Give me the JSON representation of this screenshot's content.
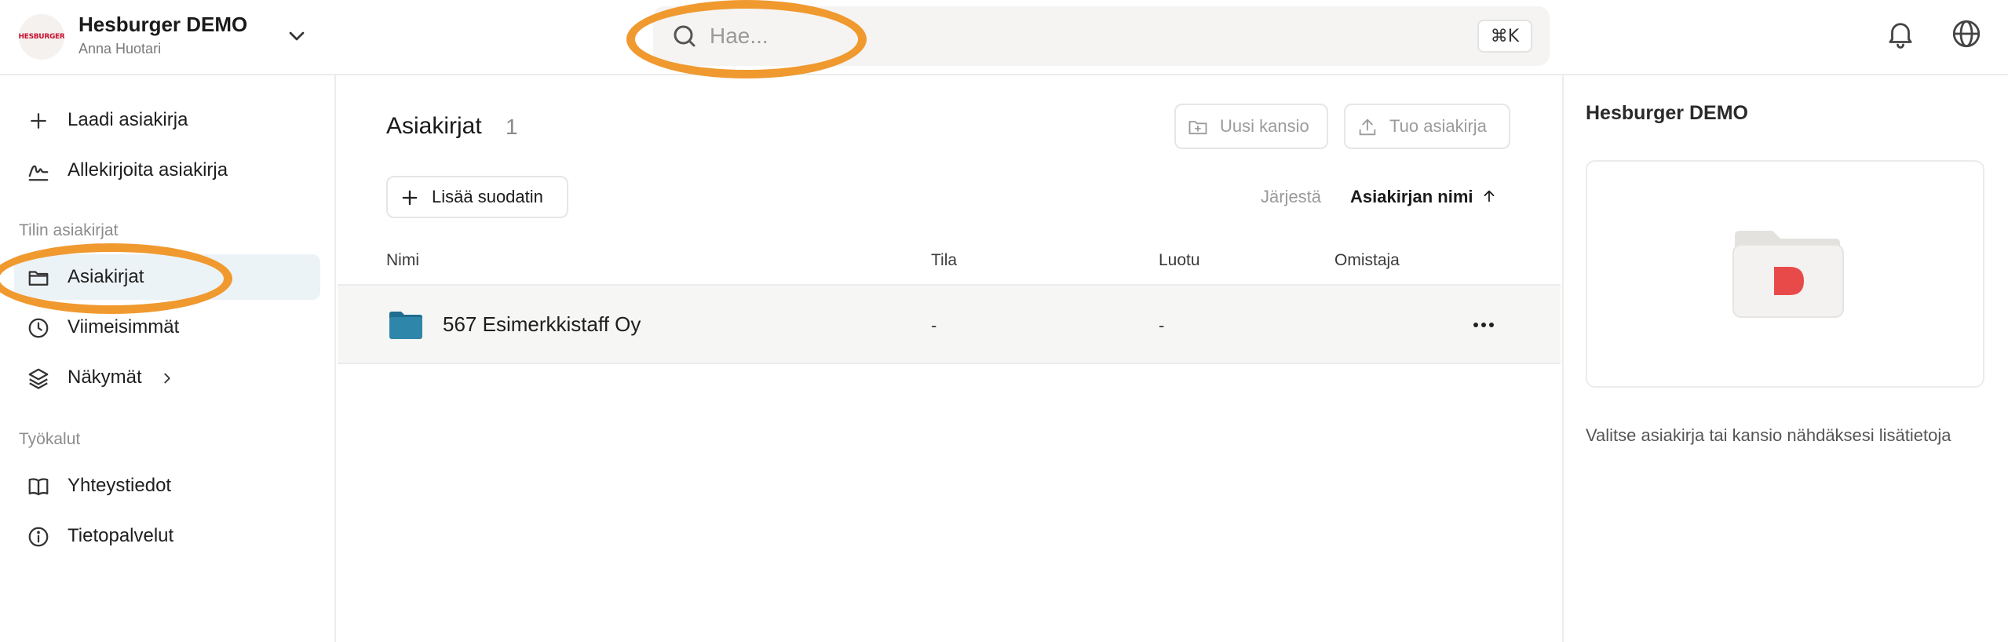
{
  "header": {
    "org_name": "Hesburger DEMO",
    "user_name": "Anna Huotari",
    "logo_text": "HESBURGER",
    "search_placeholder": "Hae...",
    "search_shortcut": "⌘K"
  },
  "sidebar": {
    "actions": [
      {
        "label": "Laadi asiakirja",
        "icon": "plus-icon"
      },
      {
        "label": "Allekirjoita asiakirja",
        "icon": "signature-icon"
      }
    ],
    "section_documents": "Tilin asiakirjat",
    "documents": [
      {
        "label": "Asiakirjat",
        "icon": "folder-icon",
        "active": true
      },
      {
        "label": "Viimeisimmät",
        "icon": "clock-icon"
      },
      {
        "label": "Näkymät",
        "icon": "layers-icon"
      }
    ],
    "section_tools": "Työkalut",
    "tools": [
      {
        "label": "Yhteystiedot",
        "icon": "book-icon"
      },
      {
        "label": "Tietopalvelut",
        "icon": "info-icon"
      }
    ]
  },
  "main": {
    "title": "Asiakirjat",
    "count": "1",
    "new_folder_label": "Uusi kansio",
    "import_label": "Tuo asiakirja",
    "add_filter_label": "Lisää suodatin",
    "sort_label": "Järjestä",
    "sort_value": "Asiakirjan nimi",
    "columns": [
      "Nimi",
      "Tila",
      "Luotu",
      "Omistaja"
    ],
    "rows": [
      {
        "name": "567 Esimerkkistaff Oy",
        "status": "-",
        "created": "-",
        "owner": ""
      }
    ]
  },
  "right_panel": {
    "title": "Hesburger DEMO",
    "hint": "Valitse asiakirja tai kansio nähdäksesi lisätietoja"
  },
  "colors": {
    "highlight": "#f0992f",
    "active_item_bg": "#ecf3f7",
    "folder_blue": "#2e86ab",
    "brand_red": "#e84a4a"
  }
}
